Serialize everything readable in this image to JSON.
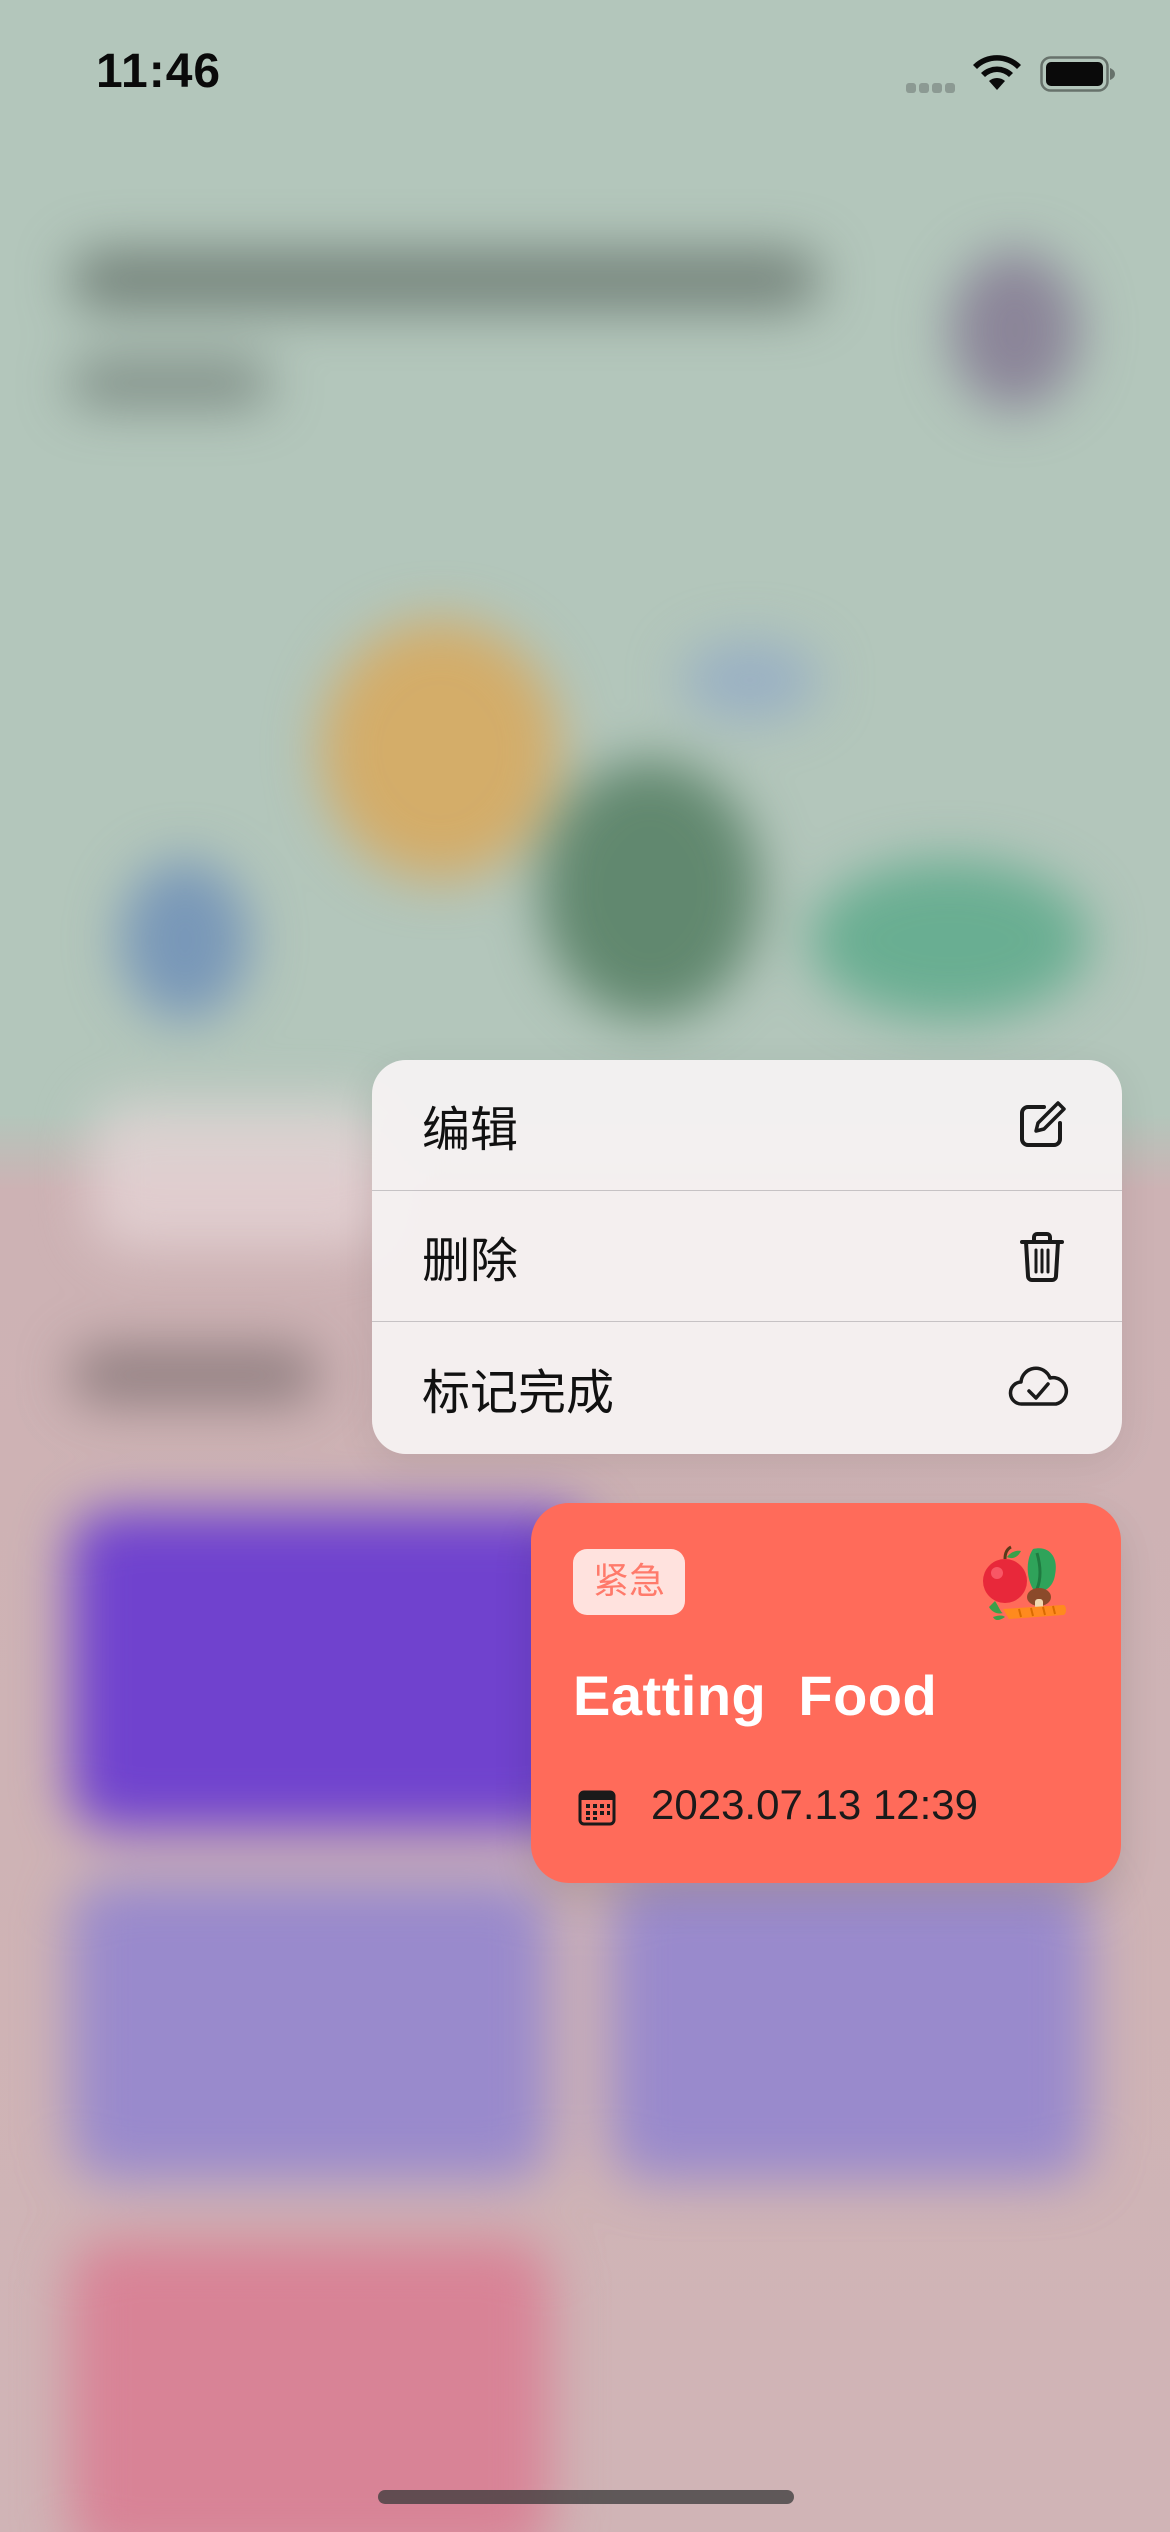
{
  "status_bar": {
    "time": "11:46"
  },
  "context_menu": {
    "items": [
      {
        "label": "编辑",
        "icon": "square-pencil-icon"
      },
      {
        "label": "删除",
        "icon": "trash-icon"
      },
      {
        "label": "标记完成",
        "icon": "cloud-check-icon"
      }
    ]
  },
  "task_card": {
    "priority": "紧急",
    "title": "Eatting  Food",
    "date": "2023.07.13 12:39",
    "icon": "food-icon",
    "color": "#ff6b5a"
  },
  "colors": {
    "accent": "#ff6b5a",
    "badge_bg": "#ffe2de",
    "background_top": "#b3c6bb",
    "background_bottom": "#d0b4b6"
  }
}
